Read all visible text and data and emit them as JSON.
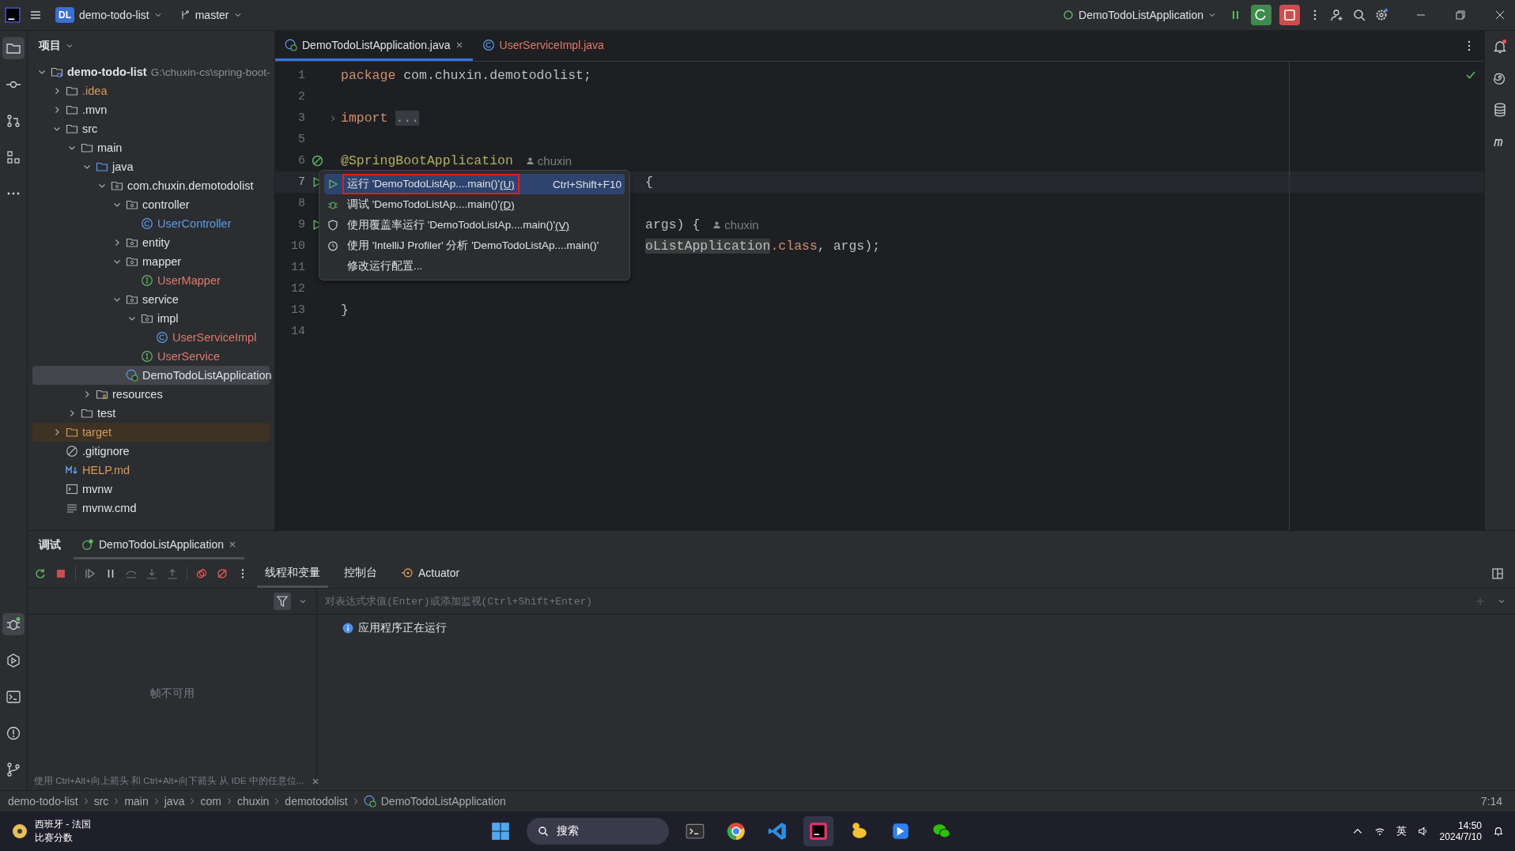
{
  "title_bar": {
    "project_badge": "DL",
    "project": "demo-todo-list",
    "branch": "master",
    "run_config": "DemoTodoListApplication"
  },
  "project": {
    "title": "项目",
    "tree": [
      {
        "label": "demo-todo-list",
        "path": "G:\\chuxin-cs\\spring-boot-",
        "kind": "module",
        "expanded": true,
        "selected": false,
        "excluded": false,
        "color": "#dfe1e5",
        "children": [
          {
            "label": ".idea",
            "kind": "folder",
            "expanded": false,
            "selected": false,
            "excluded": false,
            "color": "#d69a5a"
          },
          {
            "label": ".mvn",
            "kind": "folder",
            "expanded": false,
            "selected": false,
            "excluded": false,
            "color": "#dfe1e5"
          },
          {
            "label": "src",
            "kind": "folder",
            "expanded": true,
            "selected": false,
            "excluded": false,
            "color": "#dfe1e5",
            "children": [
              {
                "label": "main",
                "kind": "folder",
                "expanded": true,
                "selected": false,
                "excluded": false,
                "color": "#dfe1e5",
                "children": [
                  {
                    "label": "java",
                    "kind": "source-folder",
                    "expanded": true,
                    "selected": false,
                    "excluded": false,
                    "color": "#dfe1e5",
                    "children": [
                      {
                        "label": "com.chuxin.demotodolist",
                        "kind": "package",
                        "expanded": true,
                        "selected": false,
                        "excluded": false,
                        "color": "#dfe1e5",
                        "children": [
                          {
                            "label": "controller",
                            "kind": "package",
                            "expanded": true,
                            "selected": false,
                            "excluded": false,
                            "color": "#dfe1e5",
                            "children": [
                              {
                                "label": "UserController",
                                "kind": "class",
                                "selected": false,
                                "excluded": false,
                                "color": "#5c9ded"
                              }
                            ]
                          },
                          {
                            "label": "entity",
                            "kind": "package",
                            "expanded": false,
                            "selected": false,
                            "excluded": false,
                            "color": "#dfe1e5"
                          },
                          {
                            "label": "mapper",
                            "kind": "package",
                            "expanded": true,
                            "selected": false,
                            "excluded": false,
                            "color": "#dfe1e5",
                            "children": [
                              {
                                "label": "UserMapper",
                                "kind": "interface",
                                "selected": false,
                                "excluded": false,
                                "color": "#e07a6c"
                              }
                            ]
                          },
                          {
                            "label": "service",
                            "kind": "package",
                            "expanded": true,
                            "selected": false,
                            "excluded": false,
                            "color": "#dfe1e5",
                            "children": [
                              {
                                "label": "impl",
                                "kind": "package",
                                "expanded": true,
                                "selected": false,
                                "excluded": false,
                                "color": "#dfe1e5",
                                "children": [
                                  {
                                    "label": "UserServiceImpl",
                                    "kind": "class",
                                    "selected": false,
                                    "excluded": false,
                                    "color": "#e07a6c"
                                  }
                                ]
                              },
                              {
                                "label": "UserService",
                                "kind": "interface",
                                "selected": false,
                                "excluded": false,
                                "color": "#e07a6c"
                              }
                            ]
                          },
                          {
                            "label": "DemoTodoListApplication",
                            "kind": "spring-class",
                            "selected": true,
                            "excluded": false,
                            "color": "#dfe1e5"
                          }
                        ]
                      }
                    ]
                  },
                  {
                    "label": "resources",
                    "kind": "resource-folder",
                    "expanded": false,
                    "selected": false,
                    "excluded": false,
                    "color": "#dfe1e5"
                  }
                ]
              },
              {
                "label": "test",
                "kind": "folder",
                "expanded": false,
                "selected": false,
                "excluded": false,
                "color": "#dfe1e5"
              }
            ]
          },
          {
            "label": "target",
            "kind": "folder",
            "expanded": false,
            "selected": false,
            "excluded": true,
            "color": "#d69a5a"
          },
          {
            "label": ".gitignore",
            "kind": "ignore-file",
            "selected": false,
            "excluded": false,
            "color": "#dfe1e5"
          },
          {
            "label": "HELP.md",
            "kind": "markdown",
            "selected": false,
            "excluded": false,
            "color": "#d69a5a"
          },
          {
            "label": "mvnw",
            "kind": "script",
            "selected": false,
            "excluded": false,
            "color": "#dfe1e5"
          },
          {
            "label": "mvnw.cmd",
            "kind": "text-file",
            "selected": false,
            "excluded": false,
            "color": "#dfe1e5"
          }
        ]
      }
    ]
  },
  "editor": {
    "tabs": [
      {
        "label": "DemoTodoListApplication.java",
        "kind": "spring-class",
        "selected": true,
        "color": "#dfe1e5"
      },
      {
        "label": "UserServiceImpl.java",
        "kind": "class",
        "selected": false,
        "color": "#e07a6c"
      }
    ],
    "lines": [
      {
        "number": "1",
        "kind": "plain",
        "current": false,
        "tokens": [
          {
            "kind": "keyword",
            "text": "package"
          },
          {
            "kind": "plain",
            "text": " com.chuxin.demotodolist;"
          }
        ]
      },
      {
        "number": "2",
        "kind": "plain",
        "current": false
      },
      {
        "number": "3",
        "kind": "plain",
        "fold": true,
        "current": false,
        "tokens": [
          {
            "kind": "keyword",
            "text": "import"
          },
          {
            "kind": "folded",
            "text": "..."
          }
        ]
      },
      {
        "number": "5",
        "kind": "plain",
        "current": false
      },
      {
        "number": "6",
        "kind": "bean",
        "current": false,
        "tokens": [
          {
            "kind": "annotation",
            "text": "@SpringBootApplication"
          },
          {
            "kind": "author",
            "text": "chuxin"
          }
        ]
      },
      {
        "number": "7",
        "kind": "run",
        "current": true,
        "covered": true,
        "tokens": [
          {
            "kind": "plain",
            "text": "{"
          }
        ]
      },
      {
        "number": "8",
        "kind": "plain",
        "current": false
      },
      {
        "number": "9",
        "kind": "run",
        "current": false,
        "covered": true,
        "tokens": [
          {
            "kind": "plain",
            "text": "args) {"
          },
          {
            "kind": "author",
            "text": "chuxin"
          }
        ]
      },
      {
        "number": "10",
        "kind": "plain",
        "current": false,
        "covered": true,
        "tokens": [
          {
            "kind": "match",
            "text": "oListApplication"
          },
          {
            "kind": "keyword",
            "text": ".class"
          },
          {
            "kind": "plain",
            "text": ", args);"
          }
        ]
      },
      {
        "number": "11",
        "kind": "plain",
        "current": false
      },
      {
        "number": "12",
        "kind": "plain",
        "current": false
      },
      {
        "number": "13",
        "kind": "plain",
        "current": false,
        "tokens": [
          {
            "kind": "plain",
            "text": "}"
          }
        ]
      },
      {
        "number": "14",
        "kind": "plain",
        "current": false
      }
    ],
    "popup": [
      {
        "kind": "run",
        "label": "运行 'DemoTodoListAp....main()'",
        "mnemonic": "(U)",
        "shortcut": "Ctrl+Shift+F10",
        "selected": true,
        "outlined": true
      },
      {
        "kind": "debug",
        "label": "调试 'DemoTodoListAp....main()'",
        "mnemonic": "(D)",
        "selected": false,
        "outlined": false
      },
      {
        "kind": "coverage",
        "label": "使用覆盖率运行 'DemoTodoListAp....main()'",
        "mnemonic": "(V)",
        "selected": false,
        "outlined": false
      },
      {
        "kind": "profiler",
        "label": "使用 'IntelliJ Profiler' 分析  'DemoTodoListAp....main()'",
        "selected": false,
        "outlined": false
      },
      {
        "kind": "plain",
        "label": "修改运行配置...",
        "selected": false,
        "outlined": false
      }
    ]
  },
  "debug": {
    "title": "调试",
    "session": "DemoTodoListApplication",
    "tabs": [
      {
        "label": "线程和变量",
        "kind": "text",
        "selected": true
      },
      {
        "label": "控制台",
        "kind": "text",
        "selected": false
      },
      {
        "label": "Actuator",
        "kind": "actuator",
        "selected": false
      }
    ],
    "frames_empty": "帧不可用",
    "evaluate_placeholder": "对表达式求值(Enter)或添加监视(Ctrl+Shift+Enter)",
    "status": "应用程序正在运行",
    "hint": "使用 Ctrl+Alt+向上箭头 和 Ctrl+Alt+向下箭头 从 IDE 中的任意位..."
  },
  "status_bar": {
    "breadcrumbs": [
      "demo-todo-list",
      "src",
      "main",
      "java",
      "com",
      "chuxin",
      "demotodolist",
      "DemoTodoListApplication"
    ],
    "position": "7:14"
  },
  "taskbar": {
    "weather_title": "西班牙 - 法国",
    "weather_subtitle": "比赛分数",
    "search": "搜索",
    "input_method": "英",
    "time": "14:50",
    "date": "2024/7/10"
  }
}
